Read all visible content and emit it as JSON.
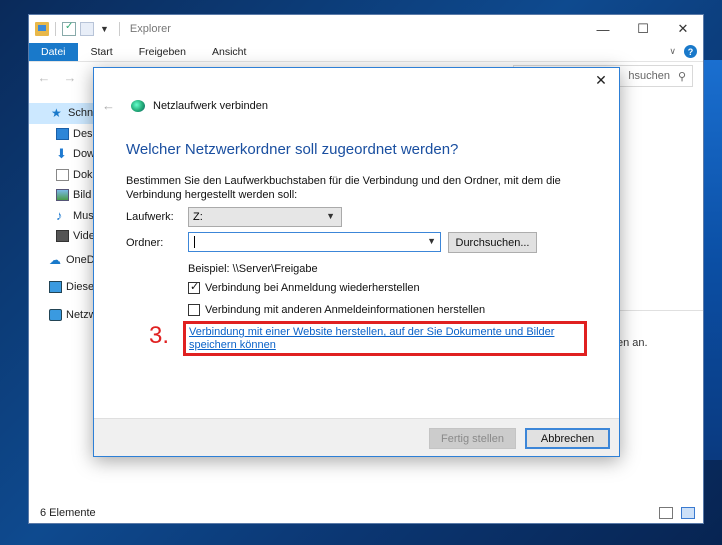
{
  "explorer": {
    "title": "Explorer",
    "ribbon_tabs": [
      "Datei",
      "Start",
      "Freigeben",
      "Ansicht"
    ],
    "search_placeholder": "hsuchen",
    "sidebar": [
      {
        "label": "Schne",
        "icon": "star-icon",
        "selected": true
      },
      {
        "label": "Desk",
        "icon": "desktop-icon"
      },
      {
        "label": "Dow",
        "icon": "download-icon"
      },
      {
        "label": "Dok",
        "icon": "document-icon"
      },
      {
        "label": "Bild",
        "icon": "picture-icon"
      },
      {
        "label": "Mus",
        "icon": "music-icon"
      },
      {
        "label": "Vide",
        "icon": "video-icon"
      },
      {
        "label": "OneD",
        "icon": "cloud-icon"
      },
      {
        "label": "Dieser",
        "icon": "computer-icon"
      },
      {
        "label": "Netzw",
        "icon": "network-icon"
      }
    ],
    "pane_text": "en an.",
    "status": "6 Elemente"
  },
  "dialog": {
    "title": "Netzlaufwerk verbinden",
    "heading": "Welcher Netzwerkordner soll zugeordnet werden?",
    "description": "Bestimmen Sie den Laufwerkbuchstaben für die Verbindung und den Ordner, mit dem die Verbindung hergestellt werden soll:",
    "drive_label": "Laufwerk:",
    "drive_value": "Z:",
    "folder_label": "Ordner:",
    "folder_value": "",
    "browse_label": "Durchsuchen...",
    "example": "Beispiel: \\\\Server\\Freigabe",
    "reconnect_label": "Verbindung bei Anmeldung wiederherstellen",
    "reconnect_checked": true,
    "other_credentials_label": "Verbindung mit anderen Anmeldeinformationen herstellen",
    "other_credentials_checked": false,
    "website_link": "Verbindung mit einer Website herstellen, auf der Sie Dokumente und Bilder speichern können",
    "step_marker": "3.",
    "finish_label": "Fertig stellen",
    "cancel_label": "Abbrechen"
  },
  "colors": {
    "accent": "#1979ca",
    "highlight": "#e02020",
    "heading": "#1a4fa0",
    "link": "#0a62c8"
  }
}
